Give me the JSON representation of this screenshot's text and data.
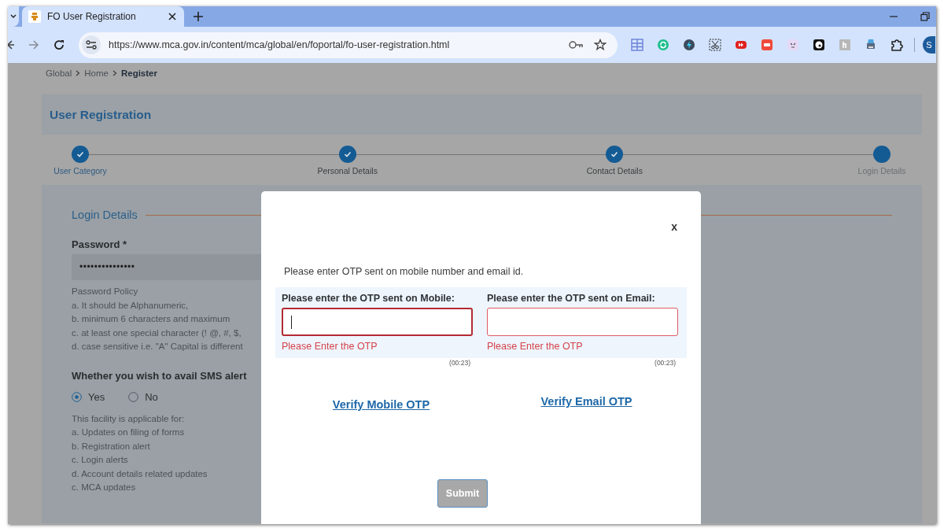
{
  "browser": {
    "tab_title": "FO User Registration",
    "url": "https://www.mca.gov.in/content/mca/global/en/foportal/fo-user-registration.html",
    "profile_initial": "S"
  },
  "breadcrumb": [
    {
      "label": "Global",
      "current": false
    },
    {
      "label": "Home",
      "current": false
    },
    {
      "label": "Register",
      "current": true
    }
  ],
  "page_title": "User Registration",
  "steps": [
    {
      "label": "User Category",
      "completed": true
    },
    {
      "label": "Personal Details",
      "completed": true
    },
    {
      "label": "Contact Details",
      "completed": true
    },
    {
      "label": "Login Details",
      "completed": false
    }
  ],
  "login_section": {
    "title": "Login Details",
    "password_label": "Password *",
    "password_value": "•••••••••••••••",
    "policy_lines": [
      "Password Policy",
      "a. It should be Alphanumeric,",
      "b. minimum 6 characters and maximum",
      "c. at least one special character (! @, #, $,",
      "d. case sensitive i.e. \"A\" Capital is different"
    ],
    "sms_question": "Whether you wish to avail SMS alert",
    "sms_options": [
      {
        "label": "Yes",
        "selected": true
      },
      {
        "label": "No",
        "selected": false
      }
    ],
    "facility_lines": [
      "This facility is applicable for:",
      "a. Updates on filing of forms",
      "b. Registration alert",
      "c. Login alerts",
      "d. Account details related updates",
      "c. MCA updates"
    ]
  },
  "modal": {
    "close": "x",
    "message": "Please enter OTP sent on mobile number and email id.",
    "otp_fields": [
      {
        "label": "Please enter the OTP sent on Mobile:",
        "focused": true,
        "error": "Please Enter the OTP",
        "timer": "(00:23)",
        "verify_link": "Verify Mobile OTP"
      },
      {
        "label": "Please enter the OTP sent on Email:",
        "focused": false,
        "error": "Please Enter the OTP",
        "timer": "(00:23)",
        "verify_link": "Verify Email OTP"
      }
    ],
    "submit": {
      "label": "Submit",
      "disabled": true
    }
  }
}
